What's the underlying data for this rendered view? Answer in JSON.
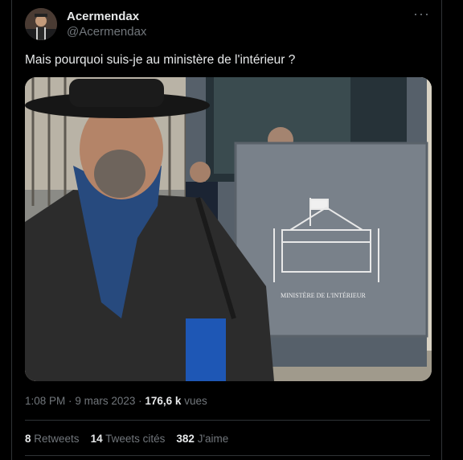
{
  "tweet": {
    "display_name": "Acermendax",
    "handle": "@Acermendax",
    "text": "Mais pourquoi suis-je au ministère de l'intérieur ?",
    "more_icon": "more-horizontal-icon",
    "photo": {
      "sign_text": "MINISTÈRE DE L'INTÉRIEUR"
    },
    "time": "1:08 PM",
    "separator": "·",
    "date": "9 mars 2023",
    "views_count": "176,6 k",
    "views_label": "vues",
    "stats": {
      "retweets_count": "8",
      "retweets_label": "Retweets",
      "quotes_count": "14",
      "quotes_label": "Tweets cités",
      "likes_count": "382",
      "likes_label": "J'aime"
    }
  }
}
